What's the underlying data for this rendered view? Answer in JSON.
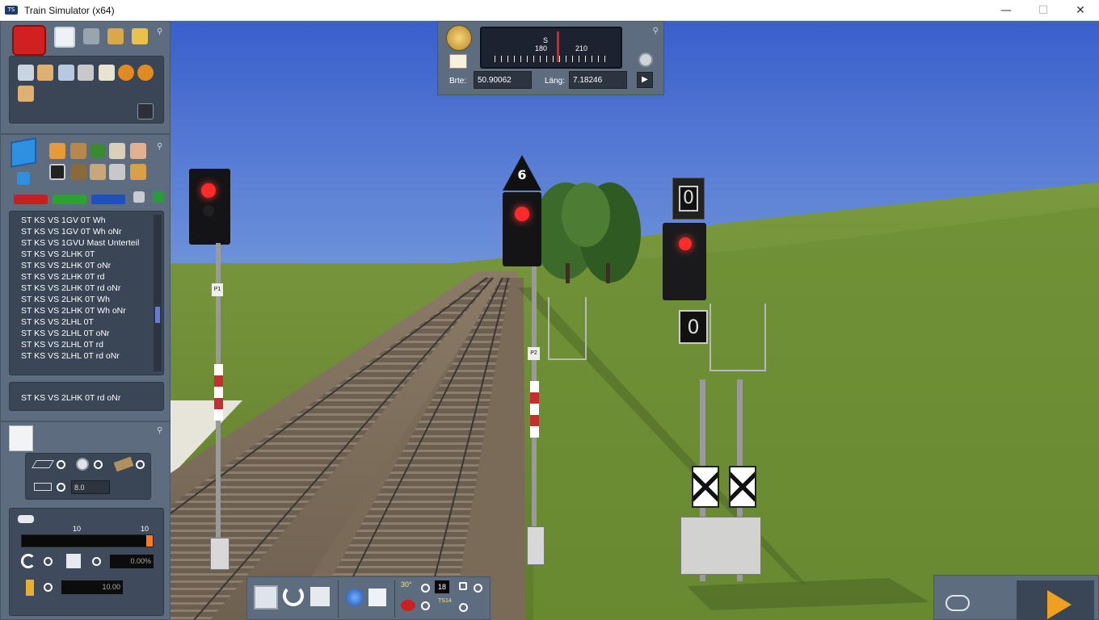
{
  "window": {
    "title": "Train Simulator (x64)",
    "app_icon_text": "TS",
    "minimize": "—",
    "maximize": "☐",
    "close": "✕"
  },
  "compass": {
    "heading_letter": "S",
    "ticks": [
      "180",
      "210"
    ],
    "brte_label": "Brte:",
    "brte_value": "50.90062",
    "lang_label": "Läng:",
    "lang_value": "7.18246",
    "go_icon": "play-icon"
  },
  "toolbar_top": {
    "tabs": [
      "toolbox-icon",
      "home-icon",
      "track-icon",
      "paint-brush-icon",
      "train-icon"
    ],
    "tools": [
      "select-icon",
      "move-icon",
      "monitor-icon",
      "delete-icon",
      "copy-icon",
      "undo-icon",
      "redo-icon",
      "ruler-icon"
    ]
  },
  "objects_panel": {
    "categories": [
      "house-icon",
      "workshop-icon",
      "tree-icon",
      "lumber-icon",
      "person-icon",
      "signal-icon",
      "plank-icon",
      "bridge-icon",
      "pipe-icon",
      "bag-icon"
    ],
    "list": [
      "ST KS VS 1GV  0T Wh",
      "ST KS VS 1GV  0T Wh oNr",
      "ST KS VS 1GVU Mast Unterteil",
      "ST KS VS 2LHK  0T",
      "ST KS VS 2LHK  0T oNr",
      "ST KS VS 2LHK  0T rd",
      "ST KS VS 2LHK  0T rd oNr",
      "ST KS VS 2LHK  0T Wh",
      "ST KS VS 2LHK  0T Wh oNr",
      "ST KS VS 2LHL  0T",
      "ST KS VS 2LHL  0T oNr",
      "ST KS VS 2LHL  0T rd",
      "ST KS VS 2LHL  0T rd oNr"
    ],
    "selected": "ST KS VS 2LHK  0T rd oNr"
  },
  "properties_panel": {
    "spacing_value": "8.0",
    "scale_left": "10",
    "scale_right": "10",
    "percent_value": "0.00%",
    "height_value": "10.00"
  },
  "bottom_toolbar": {
    "angle_label": "30°",
    "count_value": "18",
    "ts14_label": "TS14"
  },
  "signals": {
    "speed_number": "6",
    "indicator_1": "0",
    "indicator_2": "0",
    "mast_plate_1": "P1",
    "mast_plate_2": "P2"
  },
  "colors": {
    "sky_top": "#3d62c9",
    "sky_bottom": "#b6cbe6",
    "grass": "#6b8b32",
    "panel": "#5e6c80",
    "signal_red": "#ff2a2a",
    "scale_accent": "#ff7a1a"
  }
}
